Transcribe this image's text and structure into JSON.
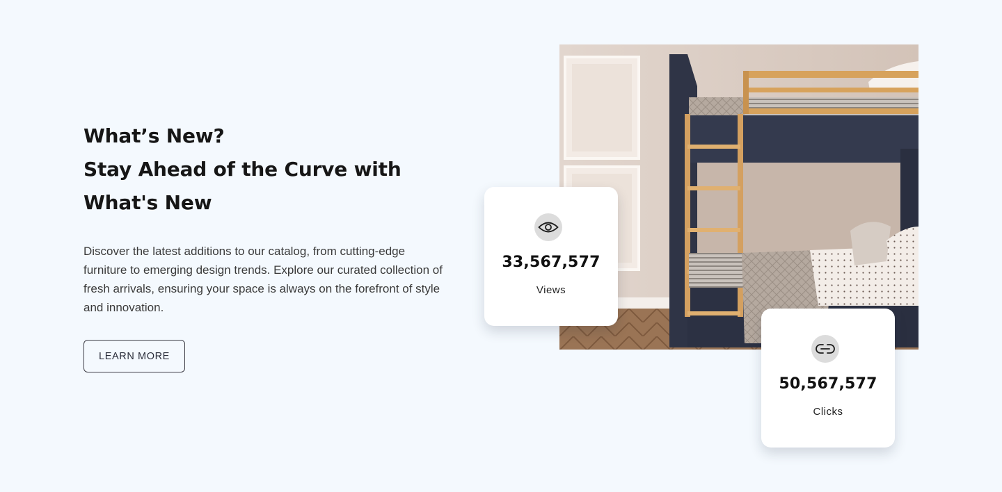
{
  "section": {
    "heading_lines": [
      "What’s New?",
      "Stay Ahead of the Curve with",
      "What's New"
    ],
    "description": "Discover the latest additions to our catalog, from cutting-edge furniture to emerging design trends. Explore our curated collection of fresh arrivals, ensuring your space is always on the forefront of style and innovation.",
    "cta_label": "LEARN MORE"
  },
  "stats": {
    "views": {
      "value": "33,567,577",
      "label": "Views",
      "icon": "eye-icon"
    },
    "clicks": {
      "value": "50,567,577",
      "label": "Clicks",
      "icon": "link-icon"
    }
  },
  "media": {
    "image_subject": "bunk-bed-photo"
  },
  "colors": {
    "background": "#f4f9fe",
    "card": "#ffffff",
    "icon_circle": "#dcdcdc",
    "text": "#161616",
    "button_border": "#3c3c46"
  }
}
